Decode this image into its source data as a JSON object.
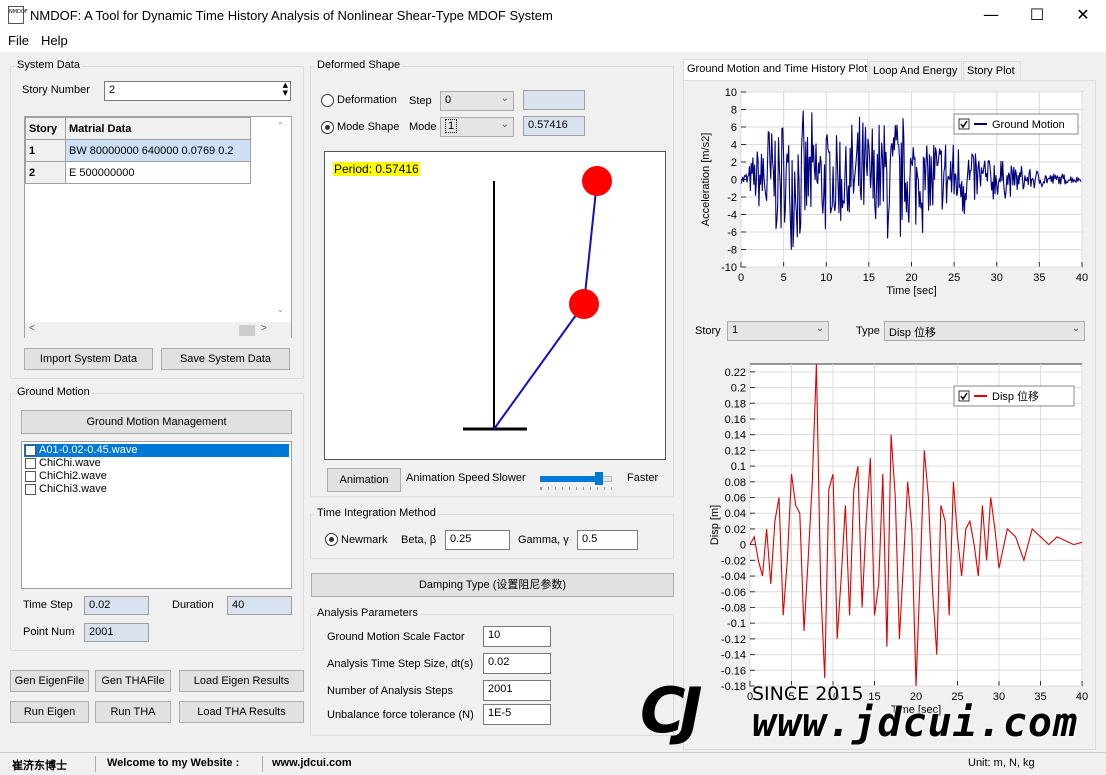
{
  "window": {
    "title": "NMDOF: A Tool for Dynamic Time History Analysis of Nonlinear Shear-Type MDOF System",
    "icon_text": "NMDOF"
  },
  "menu": [
    "File",
    "Help"
  ],
  "system_data": {
    "group_label": "System Data",
    "story_number_label": "Story Number",
    "story_number": "2",
    "table": {
      "headers": [
        "Story",
        "Matrial Data"
      ],
      "rows": [
        [
          "1",
          "BW 80000000 640000 0.0769 0.2"
        ],
        [
          "2",
          "E 500000000"
        ]
      ]
    },
    "import_button": "Import System Data",
    "save_button": "Save System Data"
  },
  "ground_motion": {
    "group_label": "Ground Motion",
    "management_button": "Ground Motion Management",
    "files": [
      "A01-0.02-0.45.wave",
      "ChiChi.wave",
      "ChiChi2.wave",
      "ChiChi3.wave"
    ],
    "time_step_label": "Time Step",
    "time_step": "0.02",
    "duration_label": "Duration",
    "duration": "40",
    "point_num_label": "Point Num",
    "point_num": "2001"
  },
  "action_buttons": {
    "gen_eigen": "Gen EigenFile",
    "gen_tha": "Gen THAFile",
    "load_eigen": "Load Eigen Results",
    "run_eigen": "Run Eigen",
    "run_tha": "Run THA",
    "load_tha": "Load THA Results"
  },
  "deformed_shape": {
    "group_label": "Deformed Shape",
    "deformation_label": "Deformation",
    "step_label": "Step",
    "step_value": "0",
    "mode_shape_label": "Mode Shape",
    "mode_label": "Mode",
    "mode_value": "1",
    "period_value": "0.57416",
    "period_text": "Period: 0.57416",
    "animation_button": "Animation",
    "animation_speed_label": "Animation Speed",
    "slower_label": "Slower",
    "faster_label": "Faster",
    "speed_level": 0.82
  },
  "time_integration": {
    "group_label": "Time Integration Method",
    "method": "Newmark",
    "beta_label": "Beta, β",
    "beta": "0.25",
    "gamma_label": "Gamma, γ",
    "gamma": "0.5"
  },
  "damping_button": "Damping Type (设置阻尼参数)",
  "analysis": {
    "group_label": "Analysis Parameters",
    "params": [
      {
        "label": "Ground Motion Scale Factor",
        "value": "10"
      },
      {
        "label": "Analysis Time Step Size, dt(s)",
        "value": "0.02"
      },
      {
        "label": "Number of Analysis Steps",
        "value": "2001"
      },
      {
        "label": "Unbalance force tolerance (N)",
        "value": "1E-5"
      }
    ]
  },
  "tabs": [
    "Ground Motion and Time History Plot",
    "Loop And Energy",
    "Story Plot"
  ],
  "story_select": {
    "story_label": "Story",
    "story_value": "1",
    "type_label": "Type",
    "type_value": "Disp 位移"
  },
  "status": {
    "author": "崔济东博士",
    "welcome": "Welcome to my Website :",
    "website": "www.jdcui.com",
    "unit": "Unit: m, N, kg"
  },
  "watermark": {
    "logo": "CJ",
    "since": "SINCE 2015",
    "url": "www.jdcui.com"
  },
  "chart_data": [
    {
      "type": "line",
      "series": [
        {
          "name": "Ground Motion",
          "color": "#00007f"
        }
      ],
      "xlabel": "Time [sec]",
      "ylabel": "Acceleration [m/s2]",
      "xlim": [
        0,
        40
      ],
      "ylim": [
        -10,
        10
      ],
      "xticks": [
        "0",
        "5",
        "10",
        "15",
        "20",
        "25",
        "30",
        "35",
        "40"
      ],
      "yticks": [
        "-10",
        "-8",
        "-6",
        "-4",
        "-2",
        "0",
        "2",
        "4",
        "6",
        "8",
        "10"
      ],
      "envelope": {
        "t": [
          0,
          1,
          2,
          3,
          4,
          5,
          6,
          8,
          10,
          12,
          14,
          16,
          18,
          20,
          22,
          24,
          26,
          28,
          30,
          32,
          34,
          36,
          38,
          40
        ],
        "amp": [
          0.5,
          2,
          5,
          9.5,
          8,
          8,
          8.5,
          8,
          7.5,
          7,
          8,
          8,
          10,
          7,
          6.5,
          6,
          5.5,
          4,
          3,
          2,
          1.5,
          1,
          0.7,
          0.4
        ]
      },
      "grid": true,
      "legend": "top-right"
    },
    {
      "type": "line",
      "series": [
        {
          "name": "Disp 位移",
          "color": "#e00000",
          "x": [
            0,
            0.5,
            1,
            1.5,
            2,
            2.5,
            3,
            3.5,
            4,
            4.5,
            5,
            5.5,
            6,
            6.5,
            7,
            7.5,
            8,
            8.5,
            9,
            9.5,
            10,
            10.5,
            11,
            11.5,
            12,
            12.5,
            13,
            13.5,
            14,
            14.5,
            15,
            15.5,
            16,
            16.5,
            17,
            17.5,
            18,
            18.5,
            19,
            19.5,
            20,
            20.5,
            21,
            21.5,
            22,
            22.5,
            23,
            23.5,
            24,
            24.5,
            25,
            25.5,
            26,
            26.5,
            27,
            27.5,
            28,
            28.5,
            29,
            29.5,
            30,
            31,
            32,
            33,
            34,
            35,
            36,
            37,
            38,
            39,
            40
          ],
          "y": [
            0,
            0.01,
            -0.02,
            -0.04,
            0.02,
            -0.05,
            0.03,
            0.06,
            -0.09,
            -0.02,
            0.09,
            0.05,
            0.04,
            -0.11,
            -0.02,
            0.08,
            0.23,
            -0.05,
            -0.17,
            0.07,
            0.09,
            -0.12,
            -0.04,
            0.05,
            -0.09,
            0.07,
            0.1,
            -0.08,
            0.03,
            0.11,
            -0.09,
            -0.05,
            0.09,
            -0.13,
            0.14,
            0.06,
            -0.12,
            -0.02,
            0.08,
            0.02,
            -0.18,
            -0.04,
            0.12,
            0.06,
            -0.06,
            -0.14,
            0.05,
            0.03,
            -0.09,
            0.08,
            0.01,
            -0.04,
            0.02,
            0.03,
            0.0,
            -0.04,
            0.05,
            -0.02,
            0.06,
            0.02,
            -0.03,
            0.02,
            0.01,
            -0.02,
            0.02,
            0.01,
            0.0,
            0.01,
            0.005,
            0.0,
            0.003
          ]
        }
      ],
      "xlabel": "Time [sec]",
      "ylabel": "Disp [m]",
      "xlim": [
        0,
        40
      ],
      "ylim": [
        -0.18,
        0.23
      ],
      "xticks": [
        "0",
        "5",
        "10",
        "15",
        "20",
        "25",
        "30",
        "35",
        "40"
      ],
      "yticks": [
        "0.22",
        "0.2",
        "0.18",
        "0.16",
        "0.14",
        "0.12",
        "0.1",
        "0.08",
        "0.06",
        "0.04",
        "0.02",
        "0",
        "-0.02",
        "-0.04",
        "-0.06",
        "-0.08",
        "-0.1",
        "-0.12",
        "-0.14",
        "-0.16",
        "-0.18"
      ],
      "grid": true,
      "legend": "top-right"
    }
  ]
}
